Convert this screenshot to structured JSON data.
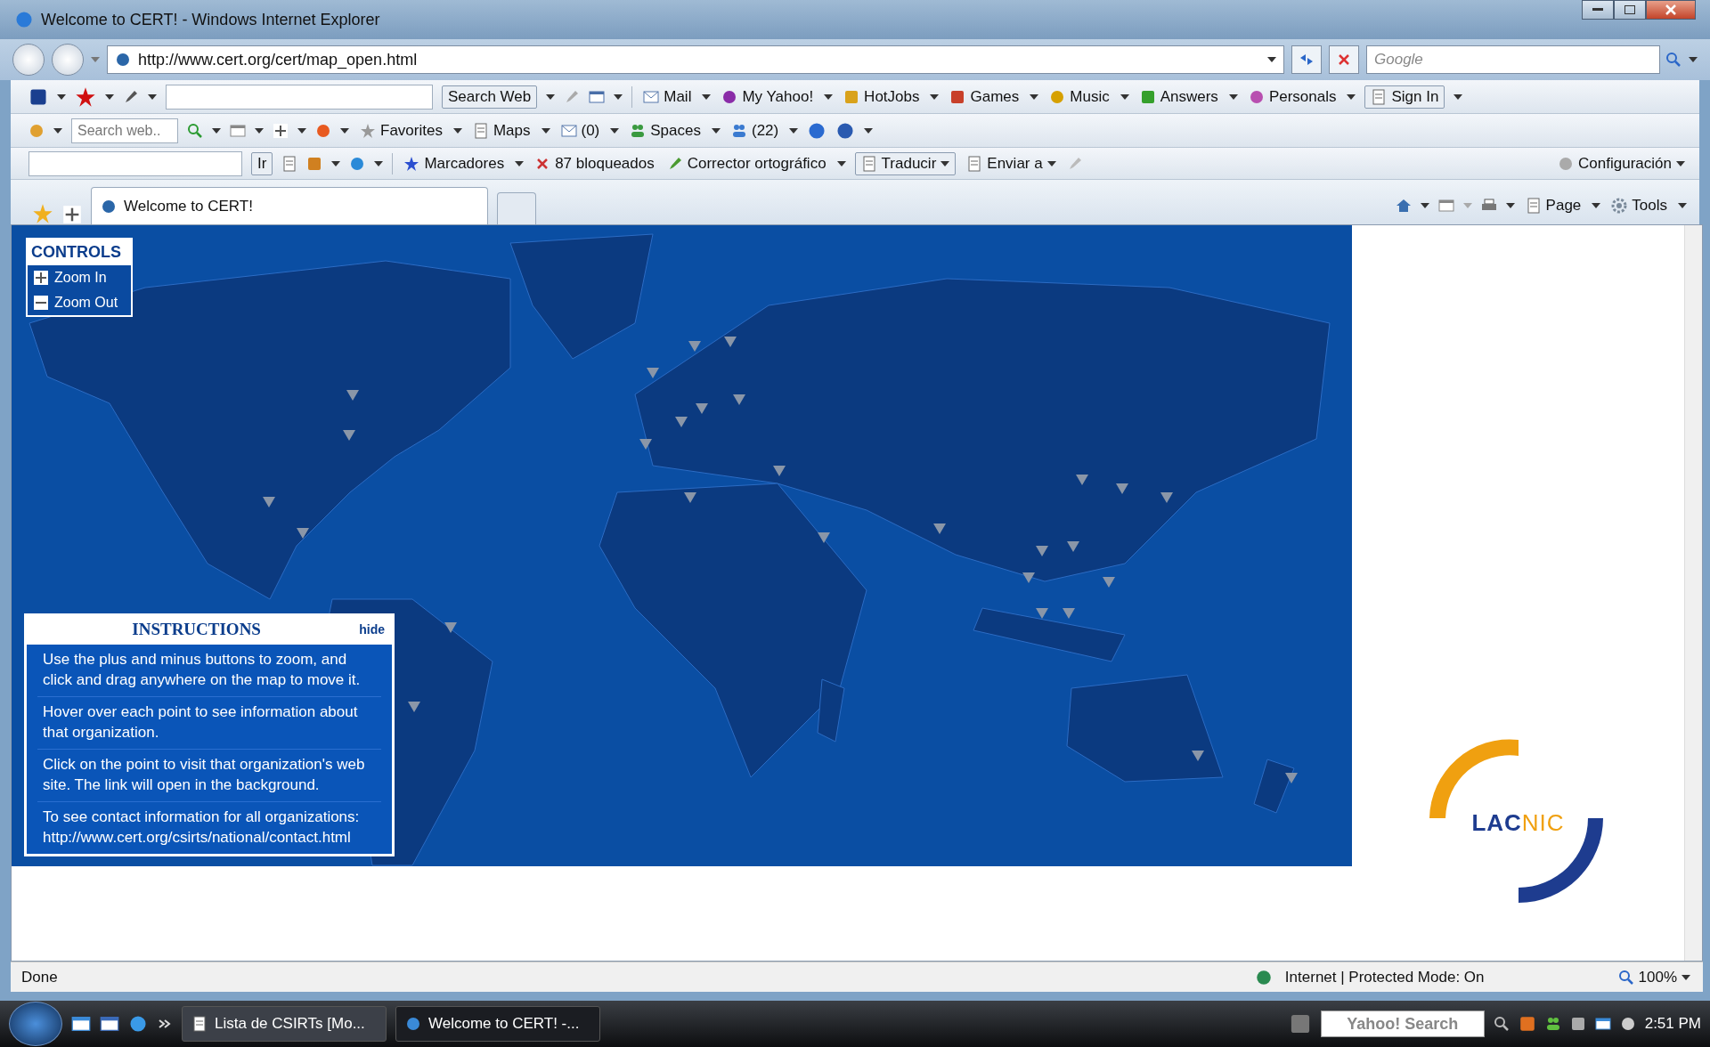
{
  "window": {
    "title": "Welcome to CERT! - Windows Internet Explorer"
  },
  "address_bar": {
    "url": "http://www.cert.org/cert/map_open.html",
    "search_placeholder": "Google"
  },
  "yahoo_toolbar": {
    "search_button": "Search Web",
    "items": [
      "Mail",
      "My Yahoo!",
      "HotJobs",
      "Games",
      "Music",
      "Answers",
      "Personals"
    ],
    "sign_in": "Sign In"
  },
  "live_toolbar": {
    "search_placeholder": "Search web..",
    "items": [
      "Favorites",
      "Maps",
      "(0)",
      "Spaces",
      "(22)"
    ]
  },
  "google_toolbar": {
    "go_button": "Ir",
    "items": [
      "Marcadores",
      "87 bloqueados",
      "Corrector ortográfico"
    ],
    "translate": "Traducir",
    "send": "Enviar a",
    "settings": "Configuración"
  },
  "tabs": [
    {
      "label": "Welcome to CERT!",
      "selected": true
    }
  ],
  "command_bar": [
    "Page",
    "Tools"
  ],
  "map_controls": {
    "title": "CONTROLS",
    "buttons": [
      "Zoom In",
      "Zoom Out"
    ]
  },
  "instructions": {
    "title": "INSTRUCTIONS",
    "hide": "hide",
    "paragraphs": [
      "Use the plus and minus buttons to zoom, and click and drag anywhere on the map to move it.",
      "Hover over each point to see information about that organization.",
      "Click on the point to visit that organization's web site. The link will open in the background.",
      "To see contact information for all organizations: http://www.cert.org/csirts/national/contact.html"
    ]
  },
  "logo": {
    "parts": [
      "LAC",
      "NIC"
    ]
  },
  "status_bar": {
    "text": "Done",
    "zone": "Internet | Protected Mode: On",
    "zoom": "100%"
  },
  "taskbar": {
    "tasks": [
      {
        "label": "Lista de CSIRTs [Mo...",
        "selected": false
      },
      {
        "label": "Welcome to CERT! -...",
        "selected": true
      }
    ],
    "search_placeholder": "Yahoo! Search",
    "clock": "2:51 PM"
  }
}
